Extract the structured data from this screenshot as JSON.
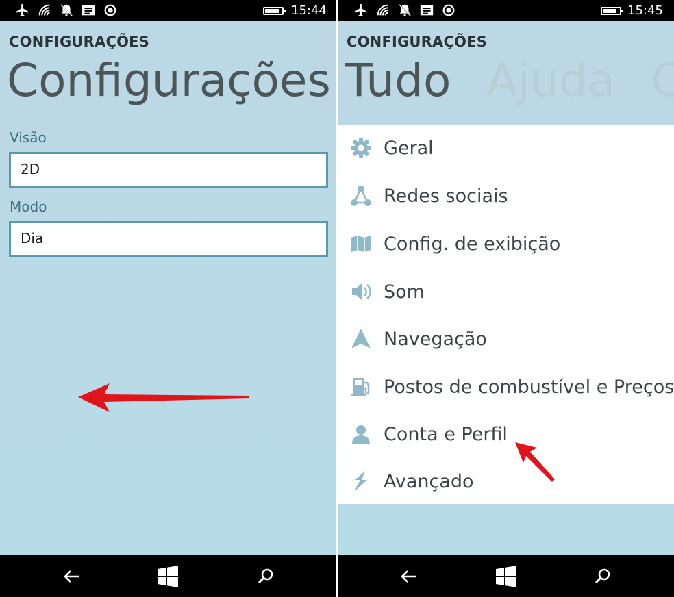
{
  "left": {
    "status": {
      "time": "15:44",
      "battery_level": 0.85
    },
    "app_caption": "CONFIGURAÇÕES",
    "page_title": "Configurações rá",
    "fields": [
      {
        "label": "Visão",
        "value": "2D"
      },
      {
        "label": "Modo",
        "value": "Dia"
      }
    ]
  },
  "right": {
    "status": {
      "time": "15:45",
      "battery_level": 0.85
    },
    "app_caption": "CONFIGURAÇÕES",
    "pivot_tabs": [
      "Tudo",
      "Ajuda",
      "Co"
    ],
    "menu": [
      {
        "label": "Geral",
        "icon": "gear-icon"
      },
      {
        "label": "Redes sociais",
        "icon": "share-network-icon"
      },
      {
        "label": "Config. de exibição",
        "icon": "map-icon"
      },
      {
        "label": "Som",
        "icon": "speaker-icon"
      },
      {
        "label": "Navegação",
        "icon": "navigation-arrow-icon"
      },
      {
        "label": "Postos de combustível e Preços",
        "icon": "fuel-pump-icon"
      },
      {
        "label": "Conta e Perfil",
        "icon": "person-icon"
      },
      {
        "label": "Avançado",
        "icon": "lightning-icon"
      }
    ]
  },
  "colors": {
    "background": "#bcd8e4",
    "field_border": "#5b98ad",
    "icon": "#8fb8c8",
    "annotation_arrow": "#e0141b",
    "bars": "#000000"
  },
  "system_nav": [
    "back-icon",
    "windows-start-icon",
    "search-icon"
  ]
}
